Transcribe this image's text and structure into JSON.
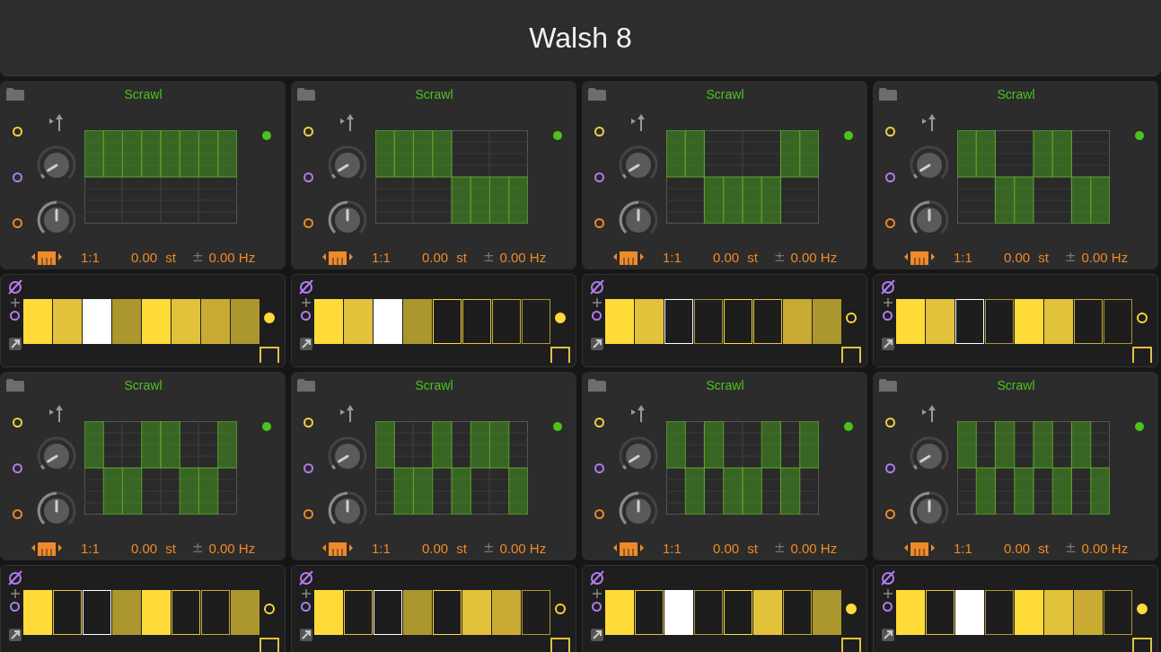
{
  "title": "Walsh 8",
  "modules": [
    {
      "name": "Scrawl",
      "ratio": "1:1",
      "pitch": "0.00",
      "pitch_unit": "st",
      "fine_sign": "±",
      "fine": "0.00 Hz",
      "knobs": [
        {
          "level": 0.05
        },
        {
          "level": 0.5
        }
      ],
      "gate_on": true,
      "steps": [
        {
          "on": true,
          "color": "#ffdb3a"
        },
        {
          "on": true,
          "color": "#e3c23b"
        },
        {
          "on": true,
          "color": "#ffffff"
        },
        {
          "on": true,
          "color": "#ac962e"
        },
        {
          "on": true,
          "color": "#ffdb3a"
        },
        {
          "on": true,
          "color": "#e3c23b"
        },
        {
          "on": true,
          "color": "#c9ab34"
        },
        {
          "on": true,
          "color": "#ac962e"
        }
      ]
    },
    {
      "name": "Scrawl",
      "ratio": "1:1",
      "pitch": "0.00",
      "pitch_unit": "st",
      "fine_sign": "±",
      "fine": "0.00 Hz",
      "knobs": [
        {
          "level": 0.05
        },
        {
          "level": 0.5
        }
      ],
      "gate_on": true,
      "steps": [
        {
          "on": true,
          "color": "#ffdb3a"
        },
        {
          "on": true,
          "color": "#e3c23b"
        },
        {
          "on": true,
          "color": "#ffffff"
        },
        {
          "on": true,
          "color": "#ac962e"
        },
        {
          "on": false,
          "color": "#ffdb3a"
        },
        {
          "on": false,
          "color": "#e3c23b"
        },
        {
          "on": false,
          "color": "#c9ab34"
        },
        {
          "on": false,
          "color": "#ac962e"
        }
      ]
    },
    {
      "name": "Scrawl",
      "ratio": "1:1",
      "pitch": "0.00",
      "pitch_unit": "st",
      "fine_sign": "±",
      "fine": "0.00 Hz",
      "knobs": [
        {
          "level": 0.05
        },
        {
          "level": 0.5
        }
      ],
      "gate_on": false,
      "steps": [
        {
          "on": true,
          "color": "#ffdb3a"
        },
        {
          "on": true,
          "color": "#e3c23b"
        },
        {
          "on": false,
          "color": "#ffffff"
        },
        {
          "on": false,
          "color": "#ac962e"
        },
        {
          "on": false,
          "color": "#ffdb3a"
        },
        {
          "on": false,
          "color": "#e3c23b"
        },
        {
          "on": true,
          "color": "#c9ab34"
        },
        {
          "on": true,
          "color": "#ac962e"
        }
      ]
    },
    {
      "name": "Scrawl",
      "ratio": "1:1",
      "pitch": "0.00",
      "pitch_unit": "st",
      "fine_sign": "±",
      "fine": "0.00 Hz",
      "knobs": [
        {
          "level": 0.05
        },
        {
          "level": 0.5
        }
      ],
      "gate_on": false,
      "steps": [
        {
          "on": true,
          "color": "#ffdb3a"
        },
        {
          "on": true,
          "color": "#e3c23b"
        },
        {
          "on": false,
          "color": "#ffffff"
        },
        {
          "on": false,
          "color": "#ac962e"
        },
        {
          "on": true,
          "color": "#ffdb3a"
        },
        {
          "on": true,
          "color": "#e3c23b"
        },
        {
          "on": false,
          "color": "#c9ab34"
        },
        {
          "on": false,
          "color": "#ac962e"
        }
      ]
    },
    {
      "name": "Scrawl",
      "ratio": "1:1",
      "pitch": "0.00",
      "pitch_unit": "st",
      "fine_sign": "±",
      "fine": "0.00 Hz",
      "knobs": [
        {
          "level": 0.05
        },
        {
          "level": 0.5
        }
      ],
      "gate_on": false,
      "steps": [
        {
          "on": true,
          "color": "#ffdb3a"
        },
        {
          "on": false,
          "color": "#e3c23b"
        },
        {
          "on": false,
          "color": "#ffffff"
        },
        {
          "on": true,
          "color": "#ac962e"
        },
        {
          "on": true,
          "color": "#ffdb3a"
        },
        {
          "on": false,
          "color": "#e3c23b"
        },
        {
          "on": false,
          "color": "#c9ab34"
        },
        {
          "on": true,
          "color": "#ac962e"
        }
      ]
    },
    {
      "name": "Scrawl",
      "ratio": "1:1",
      "pitch": "0.00",
      "pitch_unit": "st",
      "fine_sign": "±",
      "fine": "0.00 Hz",
      "knobs": [
        {
          "level": 0.05
        },
        {
          "level": 0.5
        }
      ],
      "gate_on": false,
      "steps": [
        {
          "on": true,
          "color": "#ffdb3a"
        },
        {
          "on": false,
          "color": "#e3c23b"
        },
        {
          "on": false,
          "color": "#ffffff"
        },
        {
          "on": true,
          "color": "#ac962e"
        },
        {
          "on": false,
          "color": "#ffdb3a"
        },
        {
          "on": true,
          "color": "#e3c23b"
        },
        {
          "on": true,
          "color": "#c9ab34"
        },
        {
          "on": false,
          "color": "#ac962e"
        }
      ]
    },
    {
      "name": "Scrawl",
      "ratio": "1:1",
      "pitch": "0.00",
      "pitch_unit": "st",
      "fine_sign": "±",
      "fine": "0.00 Hz",
      "knobs": [
        {
          "level": 0.05
        },
        {
          "level": 0.5
        }
      ],
      "gate_on": true,
      "steps": [
        {
          "on": true,
          "color": "#ffdb3a"
        },
        {
          "on": false,
          "color": "#e3c23b"
        },
        {
          "on": true,
          "color": "#ffffff"
        },
        {
          "on": false,
          "color": "#ac962e"
        },
        {
          "on": false,
          "color": "#ffdb3a"
        },
        {
          "on": true,
          "color": "#e3c23b"
        },
        {
          "on": false,
          "color": "#c9ab34"
        },
        {
          "on": true,
          "color": "#ac962e"
        }
      ]
    },
    {
      "name": "Scrawl",
      "ratio": "1:1",
      "pitch": "0.00",
      "pitch_unit": "st",
      "fine_sign": "±",
      "fine": "0.00 Hz",
      "knobs": [
        {
          "level": 0.05
        },
        {
          "level": 0.5
        }
      ],
      "gate_on": true,
      "steps": [
        {
          "on": true,
          "color": "#ffdb3a"
        },
        {
          "on": false,
          "color": "#e3c23b"
        },
        {
          "on": true,
          "color": "#ffffff"
        },
        {
          "on": false,
          "color": "#ac962e"
        },
        {
          "on": true,
          "color": "#ffdb3a"
        },
        {
          "on": true,
          "color": "#e3c23b"
        },
        {
          "on": true,
          "color": "#c9ab34"
        },
        {
          "on": false,
          "color": "#ac962e"
        }
      ]
    }
  ]
}
